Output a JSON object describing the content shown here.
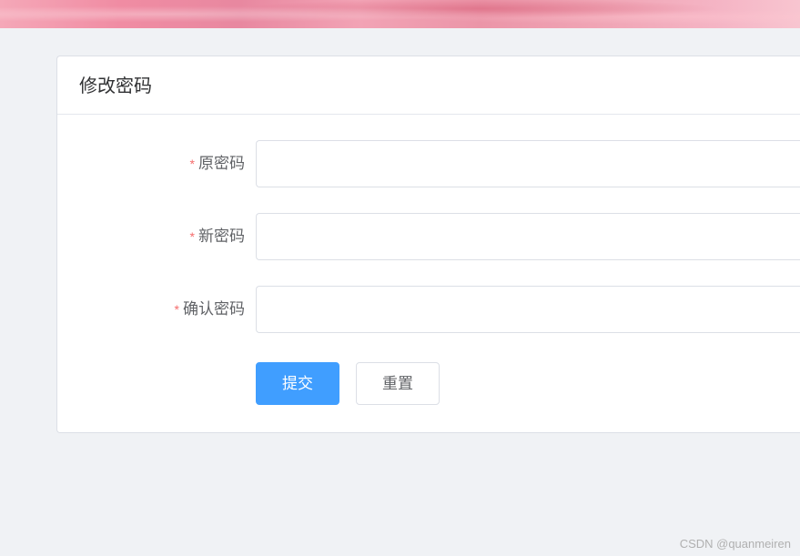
{
  "panel": {
    "title": "修改密码"
  },
  "form": {
    "old_password": {
      "label": "原密码",
      "value": ""
    },
    "new_password": {
      "label": "新密码",
      "value": ""
    },
    "confirm_password": {
      "label": "确认密码",
      "value": ""
    }
  },
  "buttons": {
    "submit": "提交",
    "reset": "重置"
  },
  "watermark": "CSDN @quanmeiren"
}
